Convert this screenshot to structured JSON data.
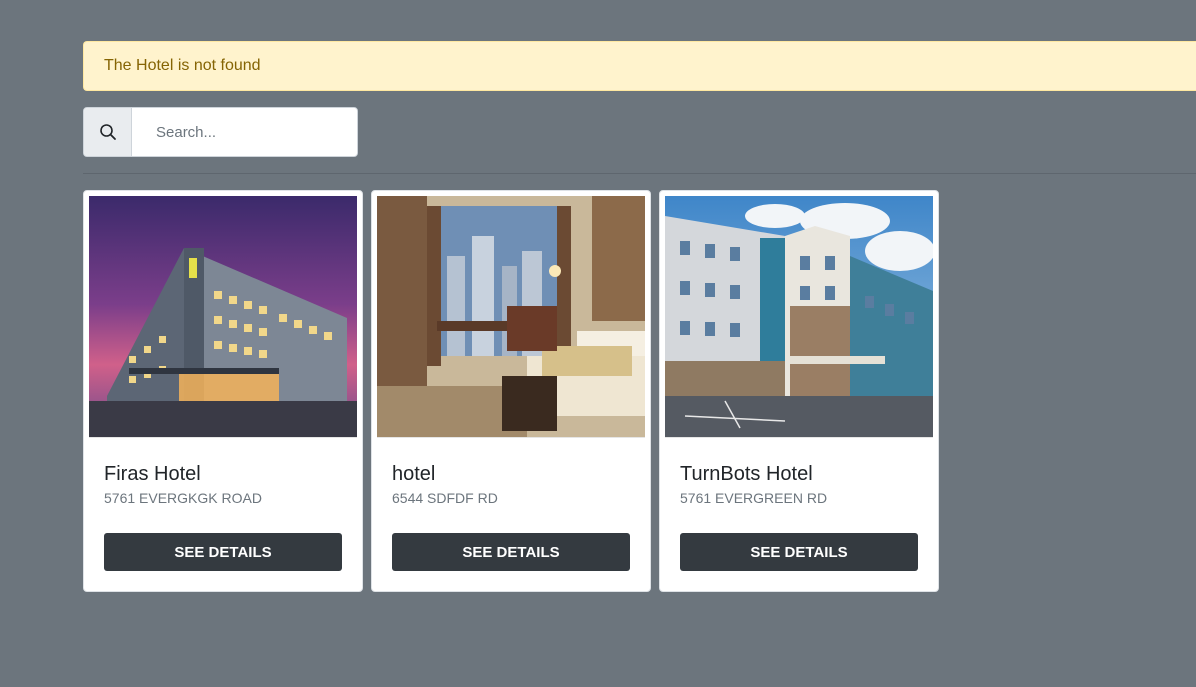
{
  "alert": {
    "message": "The Hotel is not found"
  },
  "search": {
    "placeholder": "Search...",
    "icon": "search-icon"
  },
  "hotels": [
    {
      "name": "Firas Hotel",
      "address": "5761 EVERGKGK ROAD",
      "button_label": "SEE DETAILS"
    },
    {
      "name": "hotel",
      "address": "6544 SDFDF RD",
      "button_label": "SEE DETAILS"
    },
    {
      "name": "TurnBots Hotel",
      "address": "5761 EVERGREEN RD",
      "button_label": "SEE DETAILS"
    }
  ],
  "colors": {
    "background": "#6c757d",
    "alert_bg": "#fff3cd",
    "alert_text": "#856404",
    "button_bg": "#343a40"
  }
}
